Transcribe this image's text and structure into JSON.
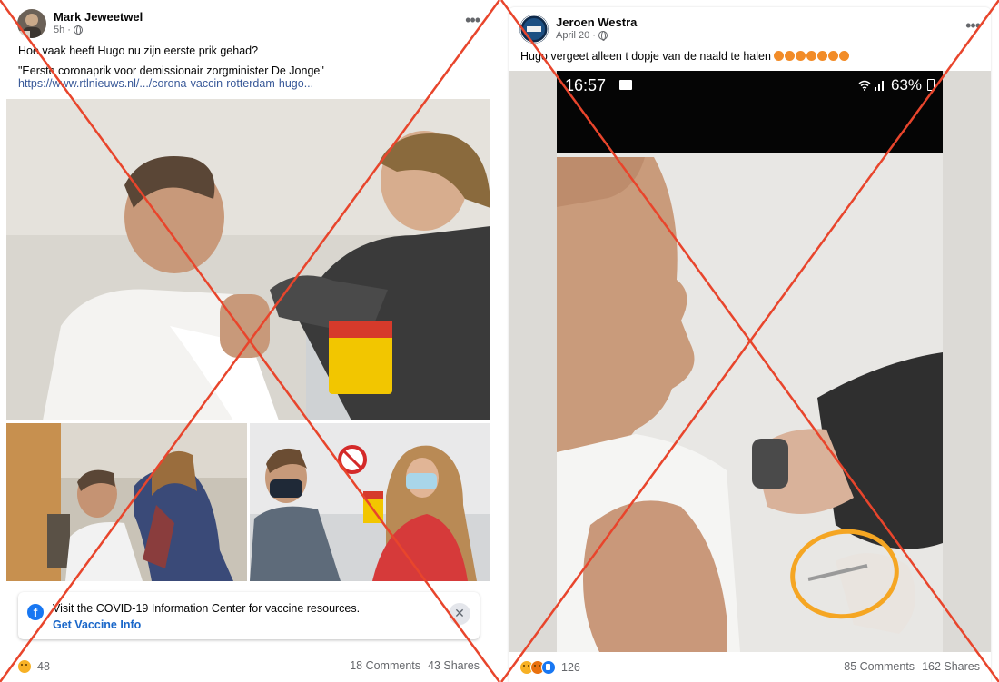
{
  "posts": [
    {
      "author": "Mark Jeweetwel",
      "time": "5h",
      "text_line1": "Hoe vaak heeft Hugo nu zijn eerste prik gehad?",
      "text_line2": "\"Eerste coronaprik voor demissionair zorgminister De Jonge\"",
      "link": "https://www.rtlnieuws.nl/.../corona-vaccin-rotterdam-hugo...",
      "info_text": "Visit the COVID-19 Information Center for vaccine resources.",
      "info_link": "Get Vaccine Info",
      "info_close": "✕",
      "reaction_count": "48",
      "comments": "18 Comments",
      "shares": "43 Shares",
      "reaction_icons": [
        "haha-icon"
      ]
    },
    {
      "author": "Jeroen Westra",
      "time": "April 20",
      "text": "Hugo vergeet alleen t dopje van de naald te halen",
      "text_emoji_count": 7,
      "phone_time": "16:57",
      "phone_battery": "63%",
      "reaction_count": "126",
      "comments": "85 Comments",
      "shares": "162 Shares",
      "reaction_icons": [
        "haha-icon",
        "angry-icon",
        "like-icon"
      ]
    }
  ],
  "colors": {
    "cross": "#e8452c",
    "link": "#385898",
    "accent": "#1877f2",
    "highlight_circle": "#f5a623"
  }
}
